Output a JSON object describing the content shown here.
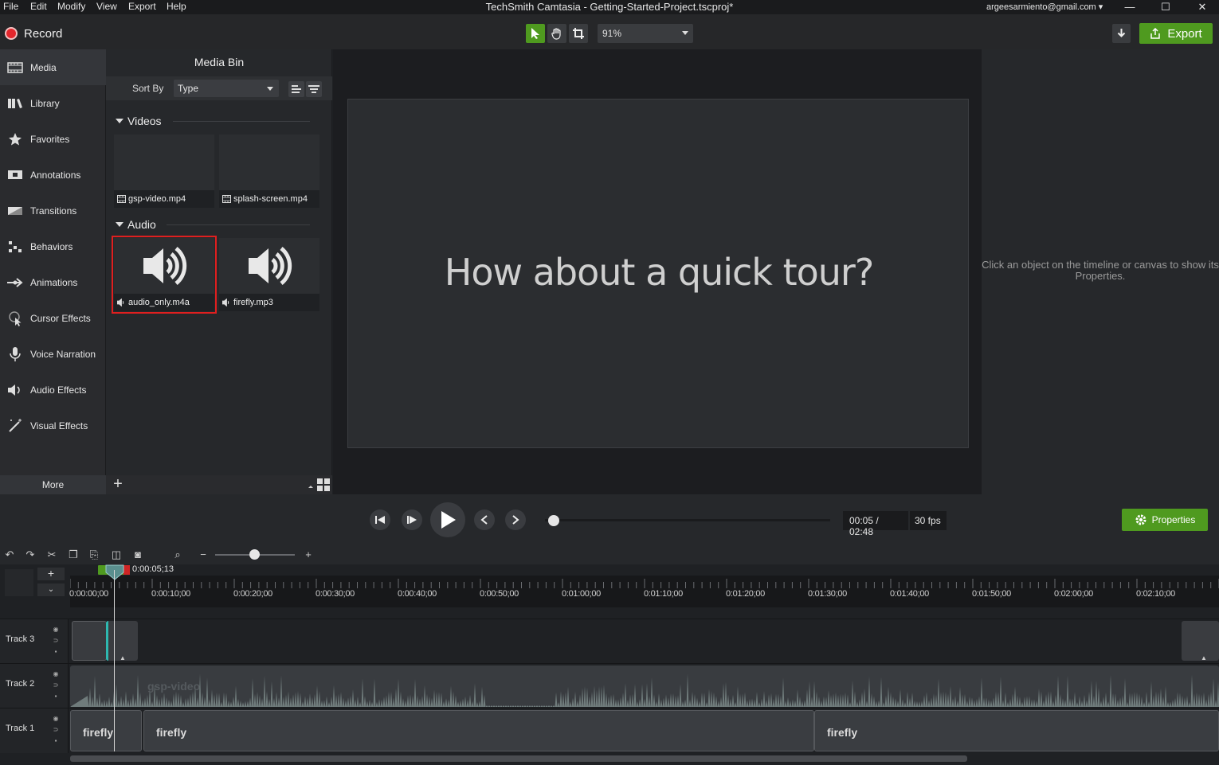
{
  "menu": {
    "items": [
      "File",
      "Edit",
      "Modify",
      "View",
      "Export",
      "Help"
    ]
  },
  "window": {
    "title": "TechSmith Camtasia - Getting-Started-Project.tscproj*",
    "account": "argeesarmiento@gmail.com"
  },
  "toolbar": {
    "record_label": "Record",
    "zoom_value": "91%",
    "export_label": "Export"
  },
  "sidebar": {
    "items": [
      {
        "label": "Media",
        "icon": "filmstrip-icon"
      },
      {
        "label": "Library",
        "icon": "books-icon"
      },
      {
        "label": "Favorites",
        "icon": "star-icon"
      },
      {
        "label": "Annotations",
        "icon": "annotation-icon"
      },
      {
        "label": "Transitions",
        "icon": "transition-icon"
      },
      {
        "label": "Behaviors",
        "icon": "behaviors-icon"
      },
      {
        "label": "Animations",
        "icon": "arrow-icon"
      },
      {
        "label": "Cursor Effects",
        "icon": "cursor-icon"
      },
      {
        "label": "Voice Narration",
        "icon": "microphone-icon"
      },
      {
        "label": "Audio Effects",
        "icon": "speaker-icon"
      },
      {
        "label": "Visual Effects",
        "icon": "wand-icon"
      }
    ],
    "more_label": "More"
  },
  "media_bin": {
    "title": "Media Bin",
    "sort_label": "Sort By",
    "sort_value": "Type",
    "sections": {
      "videos": "Videos",
      "audio": "Audio"
    },
    "videos": [
      "gsp-video.mp4",
      "splash-screen.mp4"
    ],
    "audio": [
      "audio_only.m4a",
      "firefly.mp3"
    ]
  },
  "canvas": {
    "text": "How about a quick tour?"
  },
  "properties": {
    "hint": "Click an object on the timeline or canvas to show its Properties.",
    "button_label": "Properties"
  },
  "playback": {
    "timecode": "00:05 / 02:48",
    "fps": "30 fps",
    "progress_fraction": 0.03
  },
  "timeline": {
    "playhead_time": "0:00:05;13",
    "ruler_labels": [
      "0:00:00;00",
      "0:00:10;00",
      "0:00:20;00",
      "0:00:30;00",
      "0:00:40;00",
      "0:00:50;00",
      "0:01:00;00",
      "0:01:10;00",
      "0:01:20;00",
      "0:01:30;00",
      "0:01:40;00",
      "0:01:50;00",
      "0:02:00;00",
      "0:02:10;00"
    ],
    "tracks": [
      {
        "name": "Track 3"
      },
      {
        "name": "Track 2",
        "clip": "gsp-video"
      },
      {
        "name": "Track 1",
        "clips": [
          "firefly",
          "firefly",
          "firefly"
        ]
      }
    ]
  },
  "colors": {
    "accent_green": "#4f9a1f",
    "record_red": "#e3262c",
    "selection_red": "#e01f1f"
  }
}
